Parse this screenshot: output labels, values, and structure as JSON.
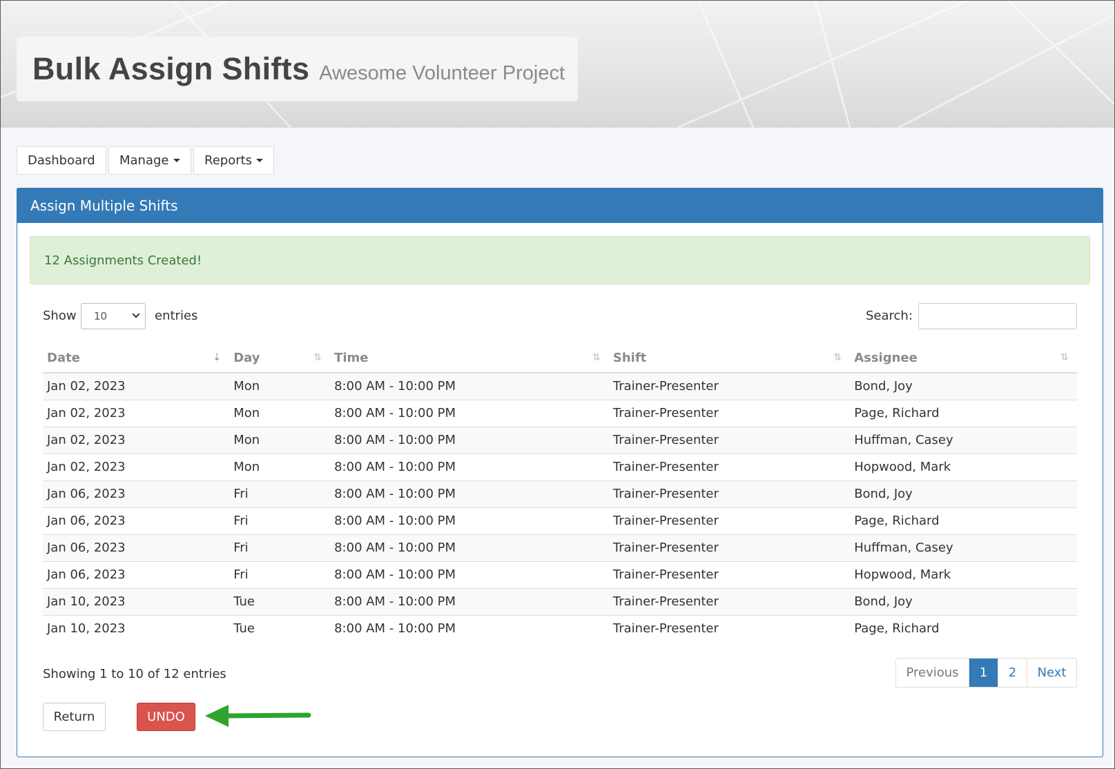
{
  "header": {
    "title": "Bulk Assign Shifts",
    "subtitle": "Awesome Volunteer Project"
  },
  "nav": {
    "dashboard": "Dashboard",
    "manage": "Manage",
    "reports": "Reports"
  },
  "panel": {
    "heading": "Assign Multiple Shifts",
    "alert": "12 Assignments Created!",
    "show_label": "Show",
    "entries_label": "entries",
    "entries_value": "10",
    "search_label": "Search:",
    "search_value": ""
  },
  "table": {
    "columns": [
      "Date",
      "Day",
      "Time",
      "Shift",
      "Assignee"
    ],
    "rows": [
      [
        "Jan 02, 2023",
        "Mon",
        "8:00 AM - 10:00 PM",
        "Trainer-Presenter",
        "Bond, Joy"
      ],
      [
        "Jan 02, 2023",
        "Mon",
        "8:00 AM - 10:00 PM",
        "Trainer-Presenter",
        "Page, Richard"
      ],
      [
        "Jan 02, 2023",
        "Mon",
        "8:00 AM - 10:00 PM",
        "Trainer-Presenter",
        "Huffman, Casey"
      ],
      [
        "Jan 02, 2023",
        "Mon",
        "8:00 AM - 10:00 PM",
        "Trainer-Presenter",
        "Hopwood, Mark"
      ],
      [
        "Jan 06, 2023",
        "Fri",
        "8:00 AM - 10:00 PM",
        "Trainer-Presenter",
        "Bond, Joy"
      ],
      [
        "Jan 06, 2023",
        "Fri",
        "8:00 AM - 10:00 PM",
        "Trainer-Presenter",
        "Page, Richard"
      ],
      [
        "Jan 06, 2023",
        "Fri",
        "8:00 AM - 10:00 PM",
        "Trainer-Presenter",
        "Huffman, Casey"
      ],
      [
        "Jan 06, 2023",
        "Fri",
        "8:00 AM - 10:00 PM",
        "Trainer-Presenter",
        "Hopwood, Mark"
      ],
      [
        "Jan 10, 2023",
        "Tue",
        "8:00 AM - 10:00 PM",
        "Trainer-Presenter",
        "Bond, Joy"
      ],
      [
        "Jan 10, 2023",
        "Tue",
        "8:00 AM - 10:00 PM",
        "Trainer-Presenter",
        "Page, Richard"
      ]
    ]
  },
  "footer": {
    "info": "Showing 1 to 10 of 12 entries",
    "pager": {
      "previous": "Previous",
      "page1": "1",
      "page2": "2",
      "next": "Next"
    },
    "return_label": "Return",
    "undo_label": "UNDO"
  },
  "colors": {
    "primary": "#337ab7",
    "success_bg": "#dff0d8",
    "danger": "#d9534f",
    "annotation_arrow": "#2ea32e"
  }
}
